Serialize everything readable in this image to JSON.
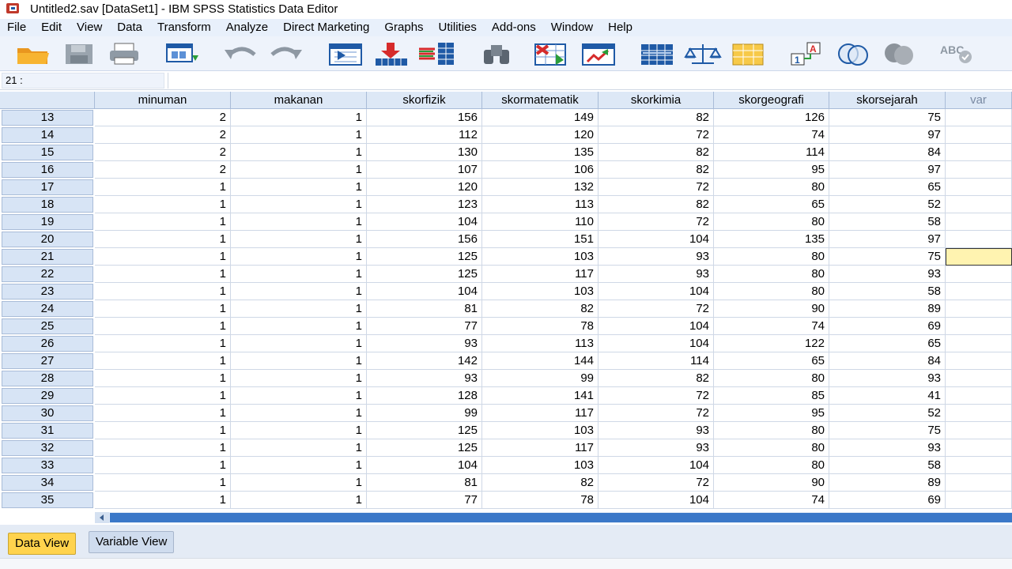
{
  "window": {
    "title": "Untitled2.sav [DataSet1] - IBM SPSS Statistics Data Editor"
  },
  "menu": [
    "File",
    "Edit",
    "View",
    "Data",
    "Transform",
    "Analyze",
    "Direct Marketing",
    "Graphs",
    "Utilities",
    "Add-ons",
    "Window",
    "Help"
  ],
  "toolbar": {
    "icons": [
      "open-folder-icon",
      "save-icon",
      "print-icon",
      "dialog-recall-icon",
      "undo-icon",
      "redo-icon",
      "goto-case-icon",
      "goto-variable-icon",
      "variables-icon",
      "find-icon",
      "insert-cases-icon",
      "insert-variable-icon",
      "split-file-icon",
      "weight-cases-icon",
      "select-cases-icon",
      "value-labels-icon",
      "use-variable-sets-icon",
      "show-all-variables-icon",
      "spell-check-icon"
    ],
    "spell_label": "ABC"
  },
  "cell_ref": {
    "label": "21 :",
    "value": ""
  },
  "grid": {
    "columns": [
      "minuman",
      "makanan",
      "skorfizik",
      "skormatematik",
      "skorkimia",
      "skorgeografi",
      "skorsejarah",
      "var"
    ],
    "rows": [
      {
        "id": "13",
        "cells": [
          "2",
          "1",
          "156",
          "149",
          "82",
          "126",
          "75"
        ]
      },
      {
        "id": "14",
        "cells": [
          "2",
          "1",
          "112",
          "120",
          "72",
          "74",
          "97"
        ]
      },
      {
        "id": "15",
        "cells": [
          "2",
          "1",
          "130",
          "135",
          "82",
          "114",
          "84"
        ]
      },
      {
        "id": "16",
        "cells": [
          "2",
          "1",
          "107",
          "106",
          "82",
          "95",
          "97"
        ]
      },
      {
        "id": "17",
        "cells": [
          "1",
          "1",
          "120",
          "132",
          "72",
          "80",
          "65"
        ]
      },
      {
        "id": "18",
        "cells": [
          "1",
          "1",
          "123",
          "113",
          "82",
          "65",
          "52"
        ]
      },
      {
        "id": "19",
        "cells": [
          "1",
          "1",
          "104",
          "110",
          "72",
          "80",
          "58"
        ]
      },
      {
        "id": "20",
        "cells": [
          "1",
          "1",
          "156",
          "151",
          "104",
          "135",
          "97"
        ]
      },
      {
        "id": "21",
        "cells": [
          "1",
          "1",
          "125",
          "103",
          "93",
          "80",
          "75"
        ]
      },
      {
        "id": "22",
        "cells": [
          "1",
          "1",
          "125",
          "117",
          "93",
          "80",
          "93"
        ]
      },
      {
        "id": "23",
        "cells": [
          "1",
          "1",
          "104",
          "103",
          "104",
          "80",
          "58"
        ]
      },
      {
        "id": "24",
        "cells": [
          "1",
          "1",
          "81",
          "82",
          "72",
          "90",
          "89"
        ]
      },
      {
        "id": "25",
        "cells": [
          "1",
          "1",
          "77",
          "78",
          "104",
          "74",
          "69"
        ]
      },
      {
        "id": "26",
        "cells": [
          "1",
          "1",
          "93",
          "113",
          "104",
          "122",
          "65"
        ]
      },
      {
        "id": "27",
        "cells": [
          "1",
          "1",
          "142",
          "144",
          "114",
          "65",
          "84"
        ]
      },
      {
        "id": "28",
        "cells": [
          "1",
          "1",
          "93",
          "99",
          "82",
          "80",
          "93"
        ]
      },
      {
        "id": "29",
        "cells": [
          "1",
          "1",
          "128",
          "141",
          "72",
          "85",
          "41"
        ]
      },
      {
        "id": "30",
        "cells": [
          "1",
          "1",
          "99",
          "117",
          "72",
          "95",
          "52"
        ]
      },
      {
        "id": "31",
        "cells": [
          "1",
          "1",
          "125",
          "103",
          "93",
          "80",
          "75"
        ]
      },
      {
        "id": "32",
        "cells": [
          "1",
          "1",
          "125",
          "117",
          "93",
          "80",
          "93"
        ]
      },
      {
        "id": "33",
        "cells": [
          "1",
          "1",
          "104",
          "103",
          "104",
          "80",
          "58"
        ]
      },
      {
        "id": "34",
        "cells": [
          "1",
          "1",
          "81",
          "82",
          "72",
          "90",
          "89"
        ]
      },
      {
        "id": "35",
        "cells": [
          "1",
          "1",
          "77",
          "78",
          "104",
          "74",
          "69"
        ]
      }
    ],
    "active_row": "21"
  },
  "tabs": {
    "data_view": "Data View",
    "variable_view": "Variable View",
    "active": "Data View"
  },
  "colors": {
    "accent": "#3b78c8",
    "active_tab": "#ffd34d",
    "active_cell": "#fff3b0"
  }
}
